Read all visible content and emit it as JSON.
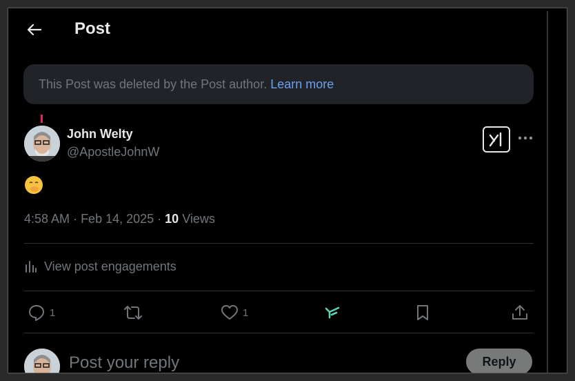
{
  "header": {
    "title": "Post"
  },
  "notice": {
    "text": "This Post was deleted by the Post author.",
    "link": "Learn more"
  },
  "post": {
    "author_name": "John Welty",
    "author_handle": "@ApostleJohnW",
    "content_emoji": "face-with-hand-over-mouth",
    "time": "4:58 AM",
    "date": "Feb 14, 2025",
    "views_count": "10",
    "views_label": "Views",
    "engagements_label": "View post engagements"
  },
  "actions": {
    "reply_count": "1",
    "like_count": "1"
  },
  "reply": {
    "placeholder": "Post your reply",
    "button": "Reply"
  },
  "colors": {
    "background": "#000000",
    "text": "#e7e9ea",
    "muted": "#71767b",
    "link": "#6ea0f0",
    "accent": "#5fd3b4"
  }
}
